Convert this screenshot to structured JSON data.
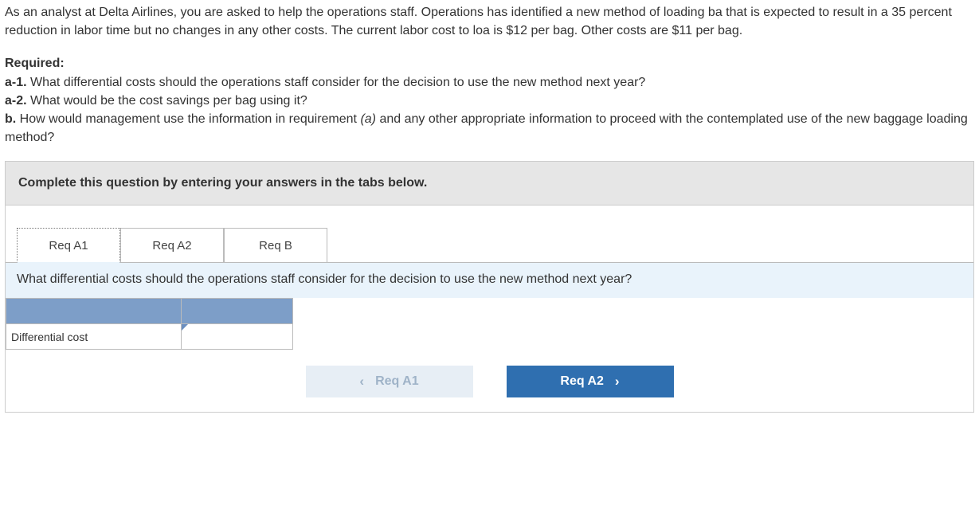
{
  "problem": {
    "intro": "As an analyst at Delta Airlines, you are asked to help the operations staff. Operations has identified a new method of loading ba that is expected to result in a 35 percent reduction in labor time but no changes in any other costs. The current labor cost to loa is $12 per bag. Other costs are $11 per bag."
  },
  "required": {
    "heading": "Required:",
    "a1_label": "a-1.",
    "a1_text": " What differential costs should the operations staff consider for the decision to use the new method next year?",
    "a2_label": "a-2.",
    "a2_text": " What would be the cost savings per bag using it?",
    "b_label": "b.",
    "b_text_pre": " How would management use the information in requirement ",
    "b_text_italic": "(a)",
    "b_text_post": " and any other appropriate information to proceed with the contemplated use of the new baggage loading method?"
  },
  "panel": {
    "instruction": "Complete this question by entering your answers in the tabs below."
  },
  "tabs": [
    {
      "label": "Req A1"
    },
    {
      "label": "Req A2"
    },
    {
      "label": "Req B"
    }
  ],
  "tab_prompt": "What differential costs should the operations staff consider for the decision to use the new method next year?",
  "table": {
    "row_label": "Differential cost",
    "input_value": ""
  },
  "nav": {
    "prev": "Req A1",
    "next": "Req A2"
  }
}
